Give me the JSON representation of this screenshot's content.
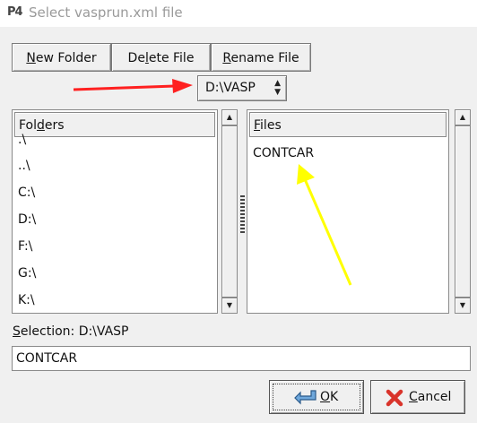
{
  "window": {
    "title": "Select vasprun.xml file",
    "app_icon_text": "P4"
  },
  "toolbar": {
    "new_folder": {
      "pre": "",
      "u": "N",
      "post": "ew Folder"
    },
    "delete_file": {
      "pre": "De",
      "u": "l",
      "post": "ete File"
    },
    "rename_file": {
      "pre": "",
      "u": "R",
      "post": "ename File"
    }
  },
  "directory_select": {
    "value": "D:\\VASP"
  },
  "folders": {
    "header": {
      "pre": "Fol",
      "u": "d",
      "post": "ers"
    },
    "items": [
      ".\\",
      "..\\",
      "C:\\",
      "D:\\",
      "F:\\",
      "G:\\",
      "K:\\"
    ]
  },
  "files": {
    "header": {
      "pre": "",
      "u": "F",
      "post": "iles"
    },
    "items": [
      "CONTCAR"
    ]
  },
  "selection": {
    "label": {
      "pre": "",
      "u": "S",
      "post": "election: D:\\VASP"
    },
    "value": "CONTCAR"
  },
  "buttons": {
    "ok": {
      "pre": "",
      "u": "O",
      "post": "K"
    },
    "cancel": {
      "pre": "",
      "u": "C",
      "post": "ancel"
    }
  },
  "annotation_colors": {
    "red_arrow": "#ff2020",
    "yellow_arrow": "#ffff00"
  }
}
